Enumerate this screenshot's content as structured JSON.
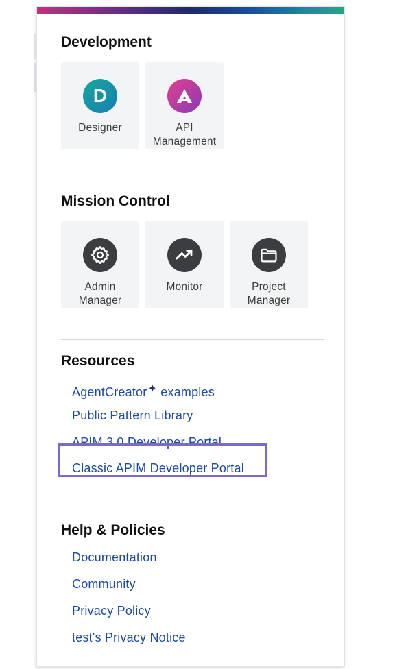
{
  "sections": {
    "development": {
      "title": "Development",
      "tiles": [
        {
          "label": "Designer",
          "icon": "designer-logo-icon",
          "glyph": "D"
        },
        {
          "label": "API\nManagement",
          "icon": "api-management-logo-icon",
          "glyph": "A"
        }
      ]
    },
    "mission_control": {
      "title": "Mission Control",
      "tiles": [
        {
          "label": "Admin\nManager",
          "icon": "gear-icon"
        },
        {
          "label": "Monitor",
          "icon": "trend-up-icon"
        },
        {
          "label": "Project\nManager",
          "icon": "folder-icon"
        }
      ]
    },
    "resources": {
      "title": "Resources",
      "links": [
        {
          "label": "AgentCreator",
          "suffix": " examples",
          "sparkle": "✦"
        },
        {
          "label": "Public Pattern Library"
        },
        {
          "label": "APIM 3.0 Developer Portal"
        },
        {
          "label": "Classic APIM Developer Portal",
          "highlighted": true
        }
      ]
    },
    "help": {
      "title": "Help & Policies",
      "links": [
        {
          "label": "Documentation"
        },
        {
          "label": "Community"
        },
        {
          "label": "Privacy Policy"
        },
        {
          "label": "test's Privacy Notice"
        }
      ]
    }
  },
  "colors": {
    "link": "#1b4aa8",
    "highlight_border": "#7b68d4",
    "tile_bg": "#f3f4f6",
    "dark_icon": "#3b3d40"
  }
}
